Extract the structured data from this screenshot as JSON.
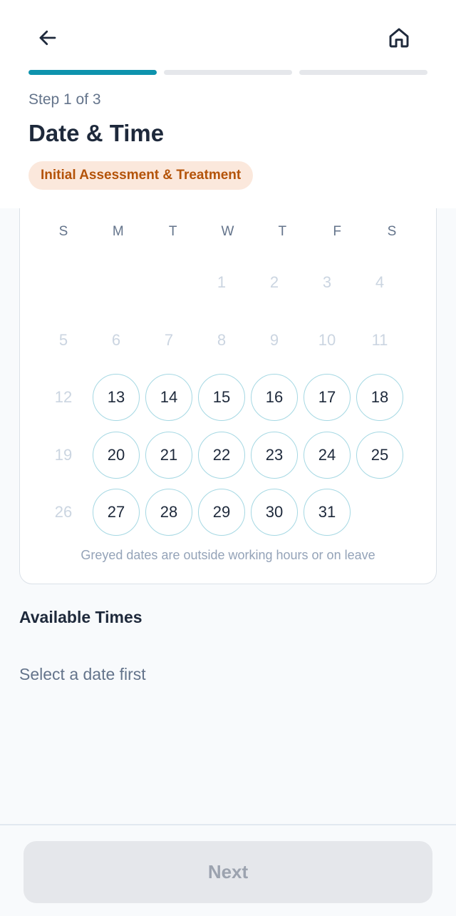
{
  "header": {
    "step_label": "Step 1 of 3",
    "title": "Date & Time",
    "service_badge": "Initial Assessment & Treatment",
    "progress": {
      "total_steps": 3,
      "current_step": 1
    },
    "back_icon": "arrow-left-icon",
    "home_icon": "home-icon"
  },
  "calendar": {
    "weekdays": [
      "S",
      "M",
      "T",
      "W",
      "T",
      "F",
      "S"
    ],
    "leading_blanks": 3,
    "days": [
      {
        "n": "1",
        "available": false
      },
      {
        "n": "2",
        "available": false
      },
      {
        "n": "3",
        "available": false
      },
      {
        "n": "4",
        "available": false
      },
      {
        "n": "5",
        "available": false
      },
      {
        "n": "6",
        "available": false
      },
      {
        "n": "7",
        "available": false
      },
      {
        "n": "8",
        "available": false
      },
      {
        "n": "9",
        "available": false
      },
      {
        "n": "10",
        "available": false
      },
      {
        "n": "11",
        "available": false
      },
      {
        "n": "12",
        "available": false
      },
      {
        "n": "13",
        "available": true
      },
      {
        "n": "14",
        "available": true
      },
      {
        "n": "15",
        "available": true
      },
      {
        "n": "16",
        "available": true
      },
      {
        "n": "17",
        "available": true
      },
      {
        "n": "18",
        "available": true
      },
      {
        "n": "19",
        "available": false
      },
      {
        "n": "20",
        "available": true
      },
      {
        "n": "21",
        "available": true
      },
      {
        "n": "22",
        "available": true
      },
      {
        "n": "23",
        "available": true
      },
      {
        "n": "24",
        "available": true
      },
      {
        "n": "25",
        "available": true
      },
      {
        "n": "26",
        "available": false
      },
      {
        "n": "27",
        "available": true
      },
      {
        "n": "28",
        "available": true
      },
      {
        "n": "29",
        "available": true
      },
      {
        "n": "30",
        "available": true
      },
      {
        "n": "31",
        "available": true
      }
    ],
    "note": "Greyed dates are outside working hours or on leave"
  },
  "times": {
    "heading": "Available Times",
    "empty_text": "Select a date first"
  },
  "footer": {
    "next_label": "Next"
  },
  "colors": {
    "accent": "#0e93ad",
    "badge_bg": "#fbe8dc",
    "badge_text": "#b45309",
    "available_ring": "#a5d8e3",
    "disabled_button": "#e5e7eb"
  }
}
